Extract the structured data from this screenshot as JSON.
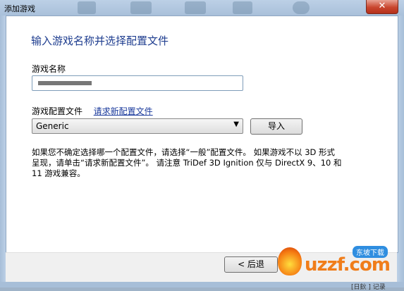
{
  "window": {
    "title": "添加游戏",
    "close_label": "✕"
  },
  "form": {
    "heading": "输入游戏名称并选择配置文件",
    "name_label": "游戏名称",
    "name_value": "",
    "profile_label": "游戏配置文件",
    "request_link": "请求新配置文件",
    "profile_selected": "Generic",
    "dropdown_arrow": "▼",
    "import_label": "导入",
    "description": "如果您不确定选择哪一个配置文件，请选择“一般”配置文件。 如果游戏不以 3D 形式呈现，请单击“请求新配置文件”。 请注意 TriDef 3D Ignition 仅与 DirectX 9、10 和 11 游戏兼容。"
  },
  "footer": {
    "back_label": "< 后退"
  },
  "watermark": {
    "text": "uzzf.com",
    "badge": "东坡下载",
    "icon": "flame-icon"
  },
  "background": {
    "corner_text": "[日鈥 ] 记录"
  },
  "colors": {
    "heading": "#1e3d8f",
    "link": "#1a3a9c",
    "close": "#c9462e"
  }
}
